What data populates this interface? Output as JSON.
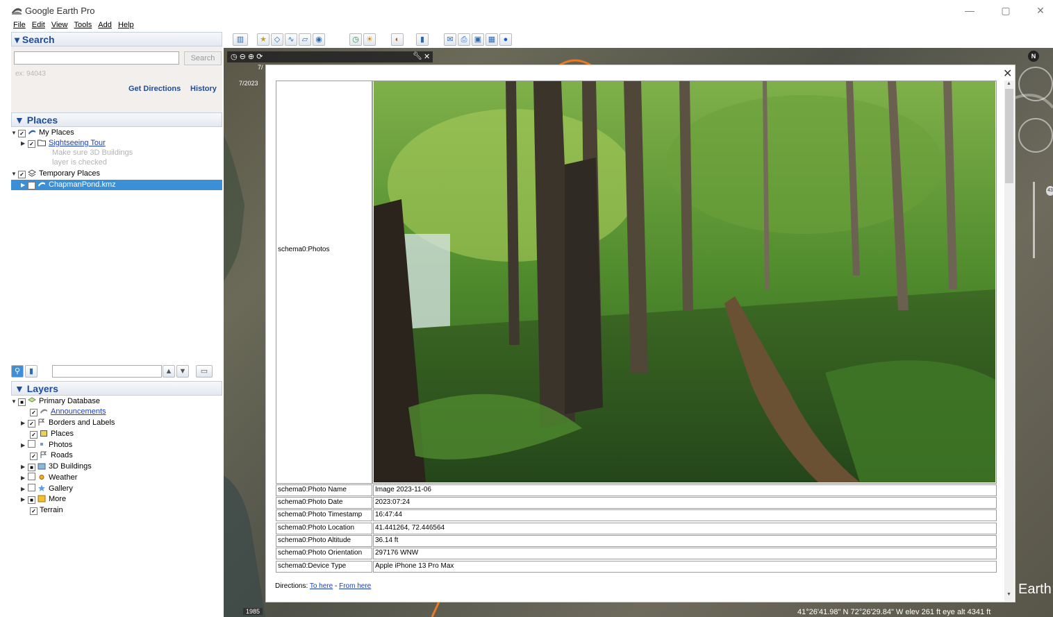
{
  "app": {
    "title": "Google Earth Pro"
  },
  "window_controls": {
    "minimize": "—",
    "maximize": "▢",
    "close": "✕"
  },
  "menu": [
    "File",
    "Edit",
    "View",
    "Tools",
    "Add",
    "Help"
  ],
  "search": {
    "header": "▾ Search",
    "input_value": "",
    "button": "Search",
    "example": "ex: 94043",
    "get_directions": "Get Directions",
    "history": "History"
  },
  "places": {
    "header": "▼ Places",
    "items": [
      {
        "label": "My Places"
      },
      {
        "label": "Sightseeing Tour"
      },
      {
        "label": "Make sure 3D Buildings"
      },
      {
        "label": "layer is checked"
      },
      {
        "label": "Temporary Places"
      },
      {
        "label": "ChapmanPond.kmz"
      }
    ]
  },
  "layers": {
    "header": "▼ Layers",
    "items": [
      {
        "label": "Primary Database"
      },
      {
        "label": "Announcements"
      },
      {
        "label": "Borders and Labels"
      },
      {
        "label": "Places"
      },
      {
        "label": "Photos"
      },
      {
        "label": "Roads"
      },
      {
        "label": "3D Buildings"
      },
      {
        "label": "Weather"
      },
      {
        "label": "Gallery"
      },
      {
        "label": "More"
      },
      {
        "label": "Terrain"
      }
    ]
  },
  "map": {
    "date_label": "7/2023",
    "date_label_small": "7/",
    "year": "1985",
    "coords": "41°26'41.98\" N   72°26'29.84\" W  elev   261 ft    eye alt  4341 ft",
    "compass_n": "N",
    "route_badge": "43",
    "earth_word": "Earth"
  },
  "popup": {
    "close": "✕",
    "photos_label": "schema0:Photos",
    "rows": [
      {
        "key": "schema0:Photo Name",
        "value": "Image 2023-11-06"
      },
      {
        "key": "schema0:Photo Date",
        "value": "2023:07:24"
      },
      {
        "key": "schema0:Photo Timestamp",
        "value": "16:47:44"
      },
      {
        "key": "schema0:Photo Location",
        "value": "41.441264, 72.446564"
      },
      {
        "key": "schema0:Photo Altitude",
        "value": "36.14 ft"
      },
      {
        "key": "schema0:Photo Orientation",
        "value": "297176 WNW"
      },
      {
        "key": "schema0:Device Type",
        "value": "Apple iPhone 13 Pro Max"
      }
    ],
    "directions_prefix": "Directions: ",
    "to_here": "To here",
    "separator": " - ",
    "from_here": "From here"
  }
}
